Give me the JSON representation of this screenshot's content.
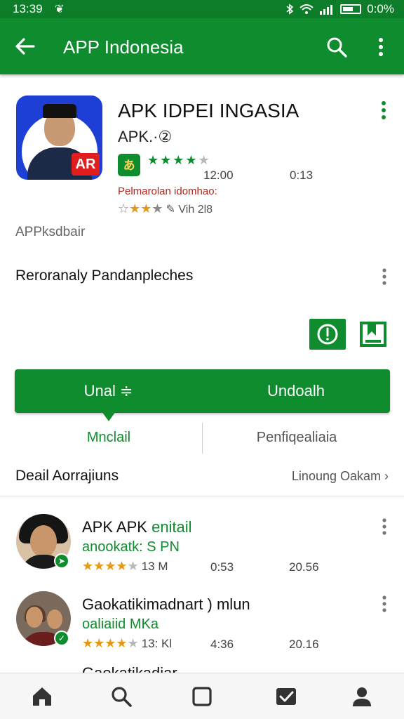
{
  "status_bar": {
    "time": "13:39",
    "app_glyph": "❦",
    "battery_text": "0:0%"
  },
  "appbar": {
    "title": "APP Indonesia"
  },
  "app": {
    "name": "APK IDPEI INGASIA",
    "subtitle": "APK.·②",
    "icon_badge": "AR",
    "dev_icon_text": "ぁ",
    "rating_green_on": "★★★★",
    "rating_green_off": "★",
    "meta_a": "12:00",
    "meta_b": "0:13",
    "red_text": "Pelmarolan idomhao:",
    "rating2_outline": "☆",
    "rating2_gold": "★★",
    "rating2_off": "★",
    "rating2_text": "✎ Vih 2l8"
  },
  "apps_label": "APPksdbair",
  "section_title": "Reroranaly Pandanpleches",
  "install_bar": {
    "left": "Unal ≑",
    "right": "Undoalh"
  },
  "tabs": {
    "left": "Mnclail",
    "right": "Penfiqealiaia"
  },
  "list": {
    "heading": "Deail Aorrajiuns",
    "link": "Linoung Oakam ›",
    "items": [
      {
        "title": "APK APK",
        "title_green": "enitail",
        "subtitle": "anookatk: S PN",
        "stars_on": "★★★★",
        "stars_off": "★",
        "count": "13 M",
        "col2": "0:53",
        "col3": "20.56"
      },
      {
        "title": "Gaokatikimadnart",
        "title_green": "",
        "title_extra": ") mlun",
        "subtitle": "oaliaiid MKa",
        "stars_on": "★★★★",
        "stars_off": "★",
        "count": "13: Kl",
        "col2": "4:36",
        "col3": "20.16"
      }
    ],
    "partial_item": "Gaokatikadiar"
  },
  "colors": {
    "primary": "#0f8c2e",
    "primary_dark": "#0d7d2a",
    "star": "#e39a1c",
    "red": "#b3261e"
  },
  "icons": [
    "back-arrow-icon",
    "search-icon",
    "more-vert-icon",
    "home-icon",
    "search-nav-icon",
    "square-icon",
    "check-box-icon",
    "person-icon"
  ]
}
